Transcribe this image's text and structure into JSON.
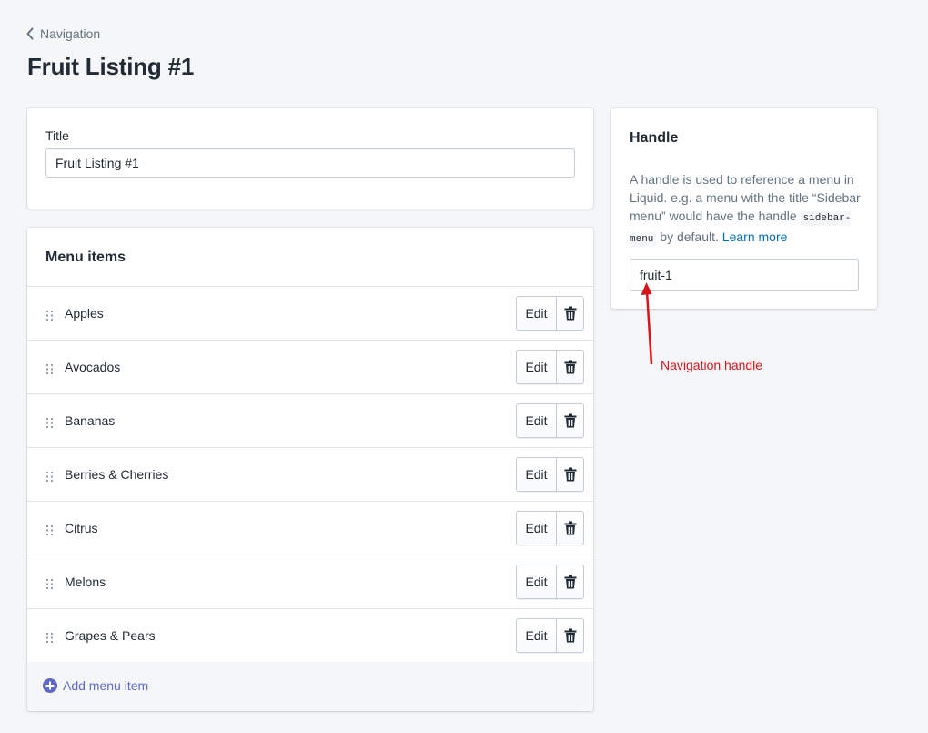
{
  "breadcrumb": {
    "label": "Navigation"
  },
  "page": {
    "title": "Fruit Listing #1"
  },
  "title_card": {
    "label": "Title",
    "value": "Fruit Listing #1"
  },
  "menu": {
    "heading": "Menu items",
    "edit_label": "Edit",
    "items": [
      {
        "label": "Apples"
      },
      {
        "label": "Avocados"
      },
      {
        "label": "Bananas"
      },
      {
        "label": "Berries & Cherries"
      },
      {
        "label": "Citrus"
      },
      {
        "label": "Melons"
      },
      {
        "label": "Grapes & Pears"
      }
    ],
    "add_label": "Add menu item"
  },
  "handle": {
    "heading": "Handle",
    "help_before": "A handle is used to reference a menu in Liquid. e.g. a menu with the title “Sidebar menu” would have the handle ",
    "help_code": "sidebar-menu",
    "help_after": " by default. ",
    "learn_more": "Learn more",
    "value": "fruit-1"
  },
  "annotation": {
    "label": "Navigation handle",
    "color": "#d8141c"
  },
  "icons": {
    "back": "chevron-left-icon",
    "drag": "drag-handle-icon",
    "delete": "trash-icon",
    "add": "plus-circle-icon"
  },
  "colors": {
    "accent": "#5c6ac4",
    "link": "#006fbb",
    "background": "#f4f6f8"
  }
}
